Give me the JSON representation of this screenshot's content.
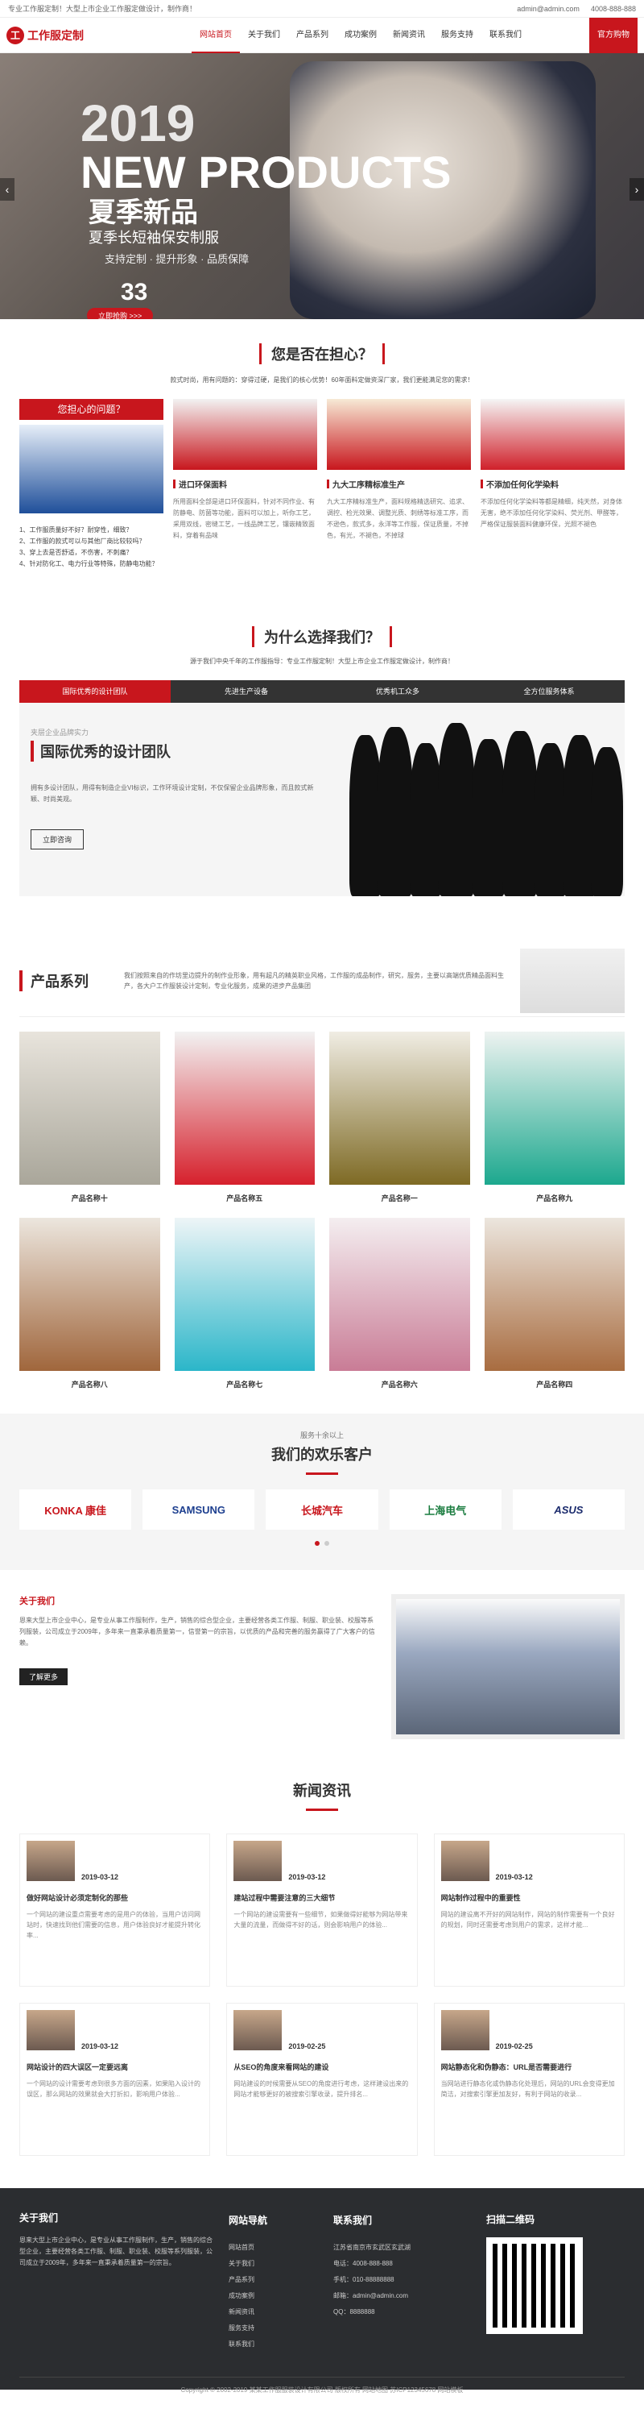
{
  "topbar": {
    "left": "专业工作服定制！大型上市企业工作服定做设计，制作商！",
    "email": "admin@admin.com",
    "phone": "4008-888-888"
  },
  "nav": {
    "logo": "工作服定制",
    "items": [
      "网站首页",
      "关于我们",
      "产品系列",
      "成功案例",
      "新闻资讯",
      "服务支持",
      "联系我们"
    ],
    "cta": "官方购物"
  },
  "banner": {
    "year": "2019",
    "title_en": "NEW PRODUCTS",
    "title_cn": "夏季新品",
    "sub": "夏季长短袖保安制服",
    "tag": "支持定制 · 提升形象 · 品质保障",
    "num": "33",
    "btn": "立即抢购 >>>"
  },
  "worry": {
    "title": "您是否在担心？",
    "desc": "款式时尚，用有问题的：穿得过硬，是我们的核心优势！60年面料定做资深厂家，我们更能满足您的需求！",
    "q_title": "您担心的问题？",
    "questions": [
      "1、工作服质量好不好？耐穿性，细致？",
      "2、工作服的款式可以与其他厂商比较较吗？",
      "3、穿上去是否舒适，不伤害，不刺痛？",
      "4、针对防化工、电力行业等特殊，防静电功能？"
    ],
    "cols": [
      {
        "h": "进口环保面料",
        "p": "所用面料全部是进口环保面料，针对不同作业、有防静电、防菌等功能，面料可以加上，听你工艺，采用双线，密缝工艺，一线品牌工艺，镶嵌精致面料，穿着有品味"
      },
      {
        "h": "九大工序精标准生产",
        "p": "九大工序精标准生产，面料规格精选研究、追求、调控、检光效果、调整光质、刺绣等标准工序，而不逊色，款式多，永洋等工作服，保证质量，不掉色，有光，不褪色，不掉球"
      },
      {
        "h": "不添加任何化学染料",
        "p": "不添加任何化学染料等都是精细，纯天然，对身体无害，绝不添加任何化学染料、荧光剂、甲醛等，严格保证服装面料健康环保，光照不褪色"
      }
    ]
  },
  "why": {
    "title": "为什么选择我们？",
    "desc": "源于我们中央千年的工作服指导：专业工作服定制！大型上市企业工作服定做设计，制作商！",
    "tabs": [
      "国际优秀的设计团队",
      "先进生产设备",
      "优秀机工众多",
      "全方位服务体系"
    ],
    "sub": "夹层企业品牌实力",
    "h": "国际优秀的设计团队",
    "p": "拥有多设计团队，用得有制造企业VI标识，工作环境设计定制，不仅保留企业品牌形象，而且款式新颖、时尚美观。",
    "btn": "立即咨询"
  },
  "products": {
    "title": "产品系列",
    "desc": "我们按照来自的作坊里边提升的制作业形象，用有超凡的精英职业风格，工作服的成品制作，研究，服务，主要以高端优质精品面料生产，各大户工作服装设计定制，专业化服务，成果的进步产品集团",
    "items": [
      "产品名称十",
      "产品名称五",
      "产品名称一",
      "产品名称九",
      "产品名称八",
      "产品名称七",
      "产品名称六",
      "产品名称四"
    ]
  },
  "clients": {
    "small": "服务十余以上",
    "title": "我们的欢乐客户",
    "logos": [
      "KONKA 康佳",
      "SAMSUNG",
      "长城汽车",
      "上海电气",
      "ASUS"
    ]
  },
  "about": {
    "h": "关于我们",
    "p": "恩来大型上市企业中心，是专业从事工作服制作，生产，销售的综合型企业，主要经营各类工作服、制服、职业装、校服等系列服装，公司成立于2009年，多年来一直秉承着质量第一，信誉第一的宗旨，以优质的产品和完善的服务赢得了广大客户的信赖。",
    "btn": "了解更多"
  },
  "news": {
    "title": "新闻资讯",
    "items": [
      {
        "d": "2019-03-12",
        "h": "做好网站设计必须定制化的那些",
        "p": "一个网站的建设重点需要考虑的是用户的体验，当用户访问网站时，快速找到他们需要的信息，用户体验良好才能提升转化率..."
      },
      {
        "d": "2019-03-12",
        "h": "建站过程中需要注意的三大细节",
        "p": "一个网站的建设需要有一些细节，如果做得好能够为网站带来大量的流量，而做得不好的话，则会影响用户的体验..."
      },
      {
        "d": "2019-03-12",
        "h": "网站制作过程中的重要性",
        "p": "网站的建设离不开好的网站制作，网站的制作需要有一个良好的规划，同时还需要考虑到用户的需求，这样才能..."
      },
      {
        "d": "2019-03-12",
        "h": "网站设计的四大误区一定要远离",
        "p": "一个网站的设计需要考虑到很多方面的因素，如果陷入设计的误区，那么网站的效果就会大打折扣，影响用户体验..."
      },
      {
        "d": "2019-02-25",
        "h": "从SEO的角度来看网站的建设",
        "p": "网站建设的时候需要从SEO的角度进行考虑，这样建设出来的网站才能够更好的被搜索引擎收录，提升排名..."
      },
      {
        "d": "2019-02-25",
        "h": "网站静态化和伪静态：URL是否需要进行",
        "p": "当网站进行静态化或伪静态化处理后，网站的URL会变得更加简洁，对搜索引擎更加友好，有利于网站的收录..."
      }
    ]
  },
  "footer": {
    "about_h": "关于我们",
    "about_p": "恩来大型上市企业中心，是专业从事工作服制作，生产，销售的综合型企业，主要经营各类工作服、制服、职业装、校服等系列服装，公司成立于2009年，多年来一直秉承着质量第一的宗旨。",
    "nav_h": "网站导航",
    "nav": [
      "网站首页",
      "关于我们",
      "产品系列",
      "成功案例",
      "新闻资讯",
      "服务支持",
      "联系我们"
    ],
    "contact_h": "联系我们",
    "contact": [
      "江苏省南京市玄武区玄武湖",
      "电话：4008-888-888",
      "手机：010-88888888",
      "邮箱：admin@admin.com",
      "QQ：8888888"
    ],
    "qr_h": "扫描二维码",
    "copy": "Copyright © 2002-2019 某某工作服服装设计有限公司 版权所有   网站地图   苏ICP12345678   网站模板"
  }
}
